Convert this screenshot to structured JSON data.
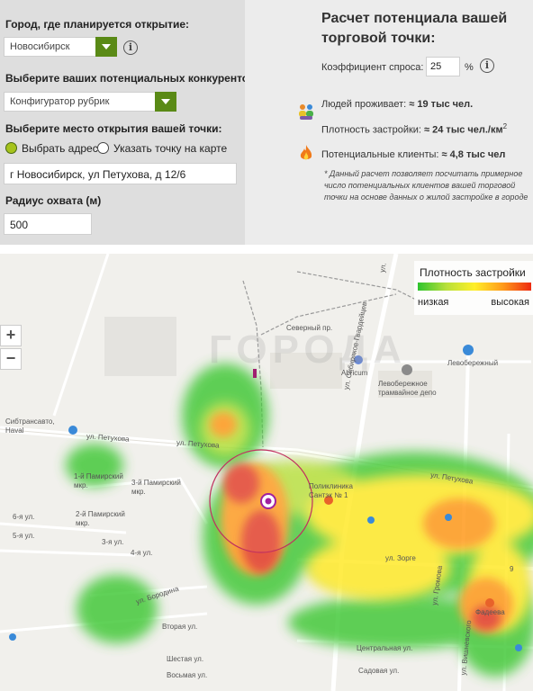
{
  "form": {
    "city_label": "Город, где планируется открытие:",
    "city_value": "Новосибирск",
    "competitors_label": "Выберите ваших потенциальных конкурентов:",
    "competitors_value": "Конфигуратор рубрик",
    "place_label": "Выберите место открытия вашей точки:",
    "radio_address": "Выбрать адрес",
    "radio_map": "Указать точку на карте",
    "address_value": "г Новосибирск, ул Петухова, д 12/6",
    "radius_label": "Радиус охвата (м)",
    "radius_value": "500",
    "info_symbol": "i"
  },
  "result": {
    "title": "Расчет потенциала вашей торговой точки:",
    "demand_label": "Коэффициент спроса:",
    "demand_value": "25",
    "demand_unit": "%",
    "residents_label": "Людей проживает:",
    "residents_value": "≈ 19 тыс чел.",
    "density_label": "Плотность застройки:",
    "density_value": "≈ 24 тыс чел./км",
    "density_sup": "2",
    "clients_label": "Потенциальные клиенты:",
    "clients_value": "≈ 4,8 тыс чел",
    "note_mark": "*",
    "note": "Данный расчет позволяет посчитать примерное число потенциальных клиентов вашей торговой точки на основе данных о жилой застройке в городе"
  },
  "map": {
    "zoom_in": "+",
    "zoom_out": "−",
    "legend_title": "Плотность застройки",
    "legend_low": "низкая",
    "legend_high": "высокая",
    "watermark": "ГОРОДА",
    "labels": {
      "severny": "Северный пр.",
      "sibiryakov": "ул. Сибиряков-Гвардейцев",
      "levoberezhny": "Левобережный",
      "abricum": "Abricum",
      "tram_depot": "Левобережное трамвайное депо",
      "sibtrans": "Сибтрансавто, Haval",
      "petukhova_w": "ул. Петухова",
      "petukhova_c": "ул. Петухова",
      "petukhova_e": "ул. Петухова",
      "first_pamir": "1-й Памирский мкр.",
      "third_pamir": "3-й Памирский мкр.",
      "second_pamir": "2-й Памирский мкр.",
      "polyclinic": "Поликлиника Сантэк № 1",
      "street_6": "6-я ул.",
      "street_5": "5-я ул.",
      "street_3": "3-я ул.",
      "street_4": "4-я ул.",
      "borodina": "ул. Бородина",
      "vtoraya": "Вторая ул.",
      "shestaya": "Шестая ул.",
      "vosmaya": "Восьмая ул.",
      "zorge": "ул. Зорге",
      "gromova": "ул. Громова",
      "vishnevskogo": "ул. Вишневского",
      "tsentralnaya": "Центральная ул.",
      "sadovaya": "Садовая ул.",
      "fadeeva": "Фадеева",
      "hexagon_num": "9",
      "ul_top": "ул."
    },
    "colors": {
      "heat_green": "#44c93a",
      "heat_yellow": "#ffe92a",
      "heat_orange": "#ff9a1a",
      "heat_red": "#e23a28",
      "accent_green": "#5a8a16",
      "radius_circle": "#c03060"
    }
  }
}
